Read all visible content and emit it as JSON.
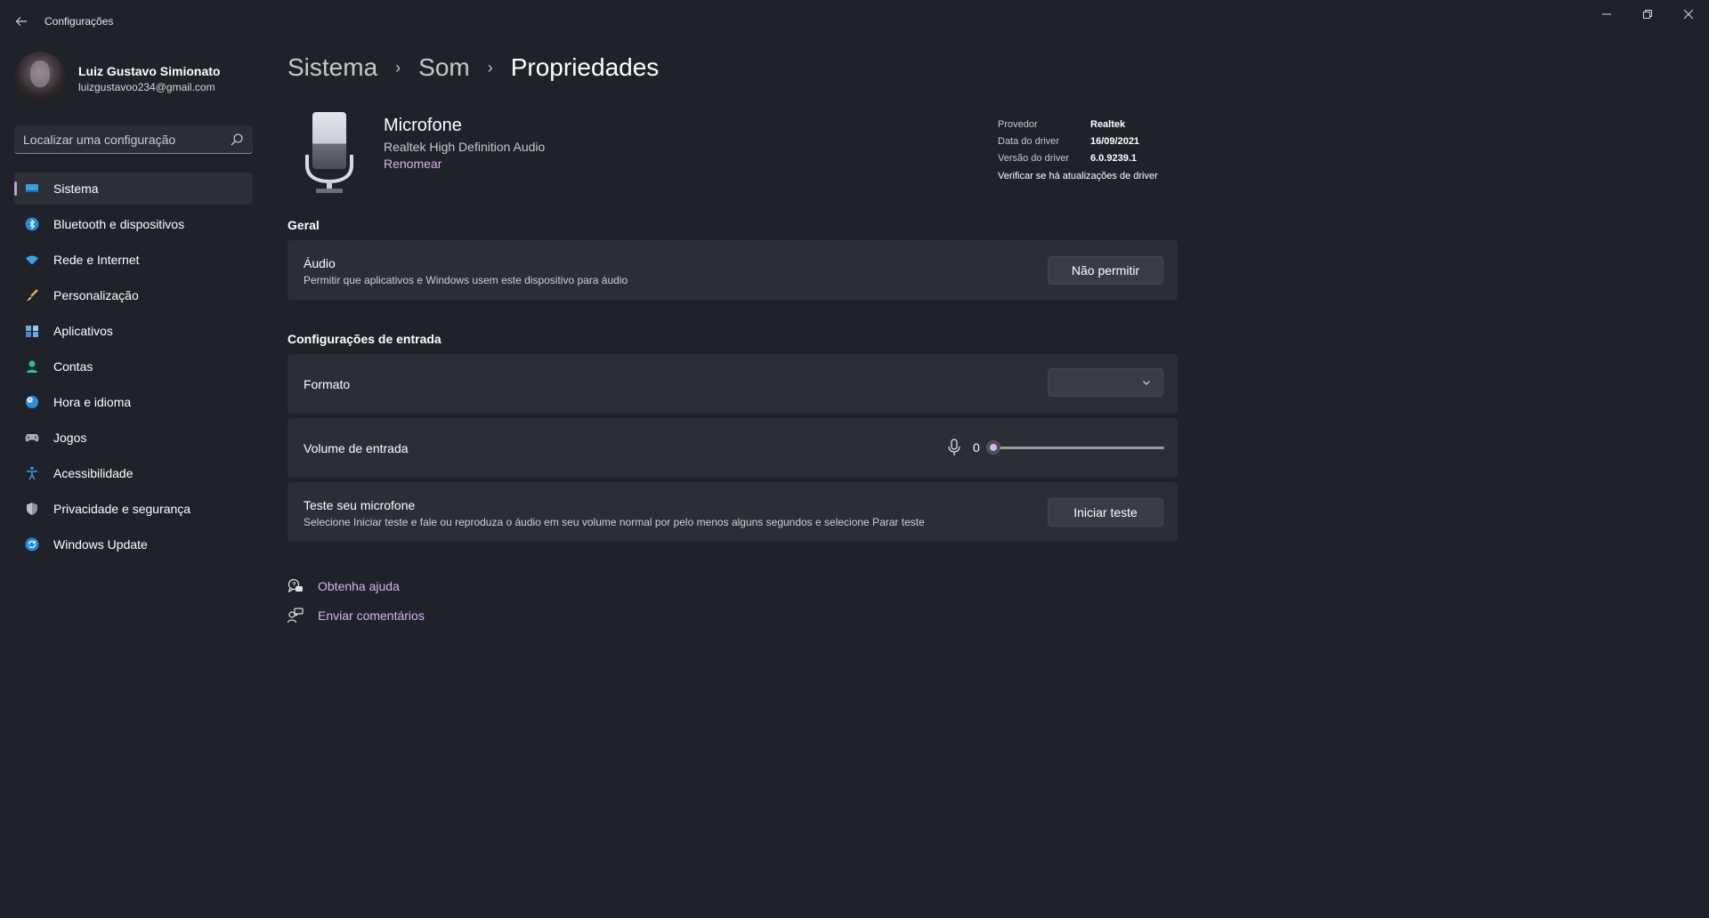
{
  "window": {
    "title": "Configurações",
    "controls": {
      "minimize": "—",
      "maximize": "❐",
      "close": "✕"
    }
  },
  "profile": {
    "name": "Luiz Gustavo Simionato",
    "email": "luizgustavoo234@gmail.com"
  },
  "search": {
    "placeholder": "Localizar uma configuração",
    "value": ""
  },
  "sidebar": {
    "items": [
      {
        "label": "Sistema",
        "icon": "display-icon",
        "active": true
      },
      {
        "label": "Bluetooth e dispositivos",
        "icon": "bluetooth-icon"
      },
      {
        "label": "Rede e Internet",
        "icon": "wifi-icon"
      },
      {
        "label": "Personalização",
        "icon": "brush-icon"
      },
      {
        "label": "Aplicativos",
        "icon": "apps-icon"
      },
      {
        "label": "Contas",
        "icon": "person-icon"
      },
      {
        "label": "Hora e idioma",
        "icon": "globe-clock-icon"
      },
      {
        "label": "Jogos",
        "icon": "gamepad-icon"
      },
      {
        "label": "Acessibilidade",
        "icon": "accessibility-icon"
      },
      {
        "label": "Privacidade e segurança",
        "icon": "shield-icon"
      },
      {
        "label": "Windows Update",
        "icon": "update-icon"
      }
    ]
  },
  "breadcrumb": {
    "items": [
      "Sistema",
      "Som",
      "Propriedades"
    ],
    "separator": "›"
  },
  "device": {
    "name": "Microfone",
    "subtitle": "Realtek High Definition Audio",
    "rename": "Renomear"
  },
  "driver": {
    "provider_label": "Provedor",
    "provider_value": "Realtek",
    "date_label": "Data do driver",
    "date_value": "16/09/2021",
    "version_label": "Versão do driver",
    "version_value": "6.0.9239.1",
    "update_link": "Verificar se há atualizações de driver"
  },
  "general": {
    "title": "Geral",
    "audio": {
      "title": "Áudio",
      "desc": "Permitir que aplicativos e Windows usem este dispositivo para áudio",
      "button": "Não permitir"
    }
  },
  "input": {
    "title": "Configurações de entrada",
    "format": {
      "label": "Formato",
      "value": ""
    },
    "volume": {
      "label": "Volume de entrada",
      "value": "0",
      "level": 0
    },
    "test": {
      "title": "Teste seu microfone",
      "desc": "Selecione Iniciar teste e fale ou reproduza o áudio em seu volume normal por pelo menos alguns segundos e selecione Parar teste",
      "button": "Iniciar teste"
    }
  },
  "help": {
    "get_help": "Obtenha ajuda",
    "feedback": "Enviar comentários"
  },
  "colors": {
    "background": "#1f2228",
    "card": "#2b2e34",
    "accent": "#d7b4f0",
    "nav_active": "#2d3036"
  }
}
